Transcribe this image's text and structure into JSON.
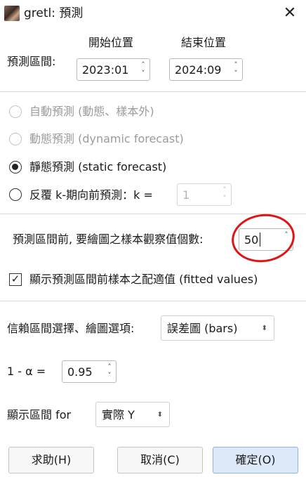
{
  "window": {
    "title": "gretl: 預測",
    "close_icon": "close-icon"
  },
  "range": {
    "start_heading": "開始位置",
    "end_heading": "結束位置",
    "label": "預測區間:",
    "start_value": "2023:01",
    "end_value": "2024:09"
  },
  "methods": {
    "auto": "自動預測 (動態、樣本外)",
    "dynamic": "動態預測 (dynamic forecast)",
    "static": "靜態預測 (static forecast)",
    "kstep": "反覆 k-期向前預測：k =",
    "k_value": "1",
    "selected": "static"
  },
  "pre_obs": {
    "label": "預測區間前, 要繪圖之樣本觀察值個數:",
    "value": "50"
  },
  "fitted": {
    "label": "顯示預測區間前樣本之配適值 (fitted values)",
    "checked": true
  },
  "conf": {
    "label": "信賴區間選擇、繪圖選項:",
    "value": "誤差圖 (bars)"
  },
  "alpha": {
    "label": "1 - α =",
    "value": "0.95"
  },
  "display": {
    "label": "顯示區間 for",
    "value": "實際 Y"
  },
  "buttons": {
    "help": "求助(H)",
    "cancel": "取消(C)",
    "ok": "確定(O)"
  }
}
